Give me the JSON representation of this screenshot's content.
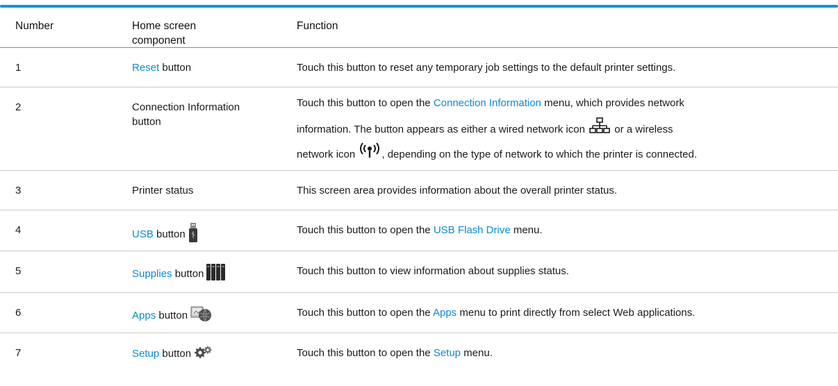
{
  "header": {
    "col1": "Number",
    "col2_line1": "Home screen",
    "col2_line2": "component",
    "col3": "Function"
  },
  "rows": [
    {
      "number": "1",
      "component_link": "Reset",
      "component_rest": " button",
      "function": "Touch this button to reset any temporary job settings to the default printer settings."
    },
    {
      "number": "2",
      "component_line1": "Connection Information",
      "component_line2": "button",
      "function_pre": "Touch this button to open the ",
      "function_link": "Connection Information",
      "function_post": " menu, which provides network",
      "function_line2_pre": "information. The button appears as either a wired network icon ",
      "function_line2_post": " or a wireless",
      "function_line3_pre": "network icon ",
      "function_line3_post": ", depending on the type of network to which the printer is connected."
    },
    {
      "number": "3",
      "component": "Printer status",
      "function": "This screen area provides information about the overall printer status."
    },
    {
      "number": "4",
      "component_link": "USB",
      "component_rest": " button",
      "icon": "usb-drive-icon",
      "function_pre": "Touch this button to open the ",
      "function_link": "USB Flash Drive",
      "function_post": " menu."
    },
    {
      "number": "5",
      "component_link": "Supplies",
      "component_rest": " button",
      "icon": "supplies-cartridges-icon",
      "function": "Touch this button to view information about supplies status."
    },
    {
      "number": "6",
      "component_link": "Apps",
      "component_rest": " button",
      "icon": "apps-globe-icon",
      "function_pre": "Touch this button to open the ",
      "function_link": "Apps",
      "function_post": " menu to print directly from select Web applications."
    },
    {
      "number": "7",
      "component_link": "Setup",
      "component_rest": " button",
      "icon": "setup-gears-icon",
      "function_pre": "Touch this button to open the ",
      "function_link": "Setup",
      "function_post": " menu."
    }
  ],
  "colors": {
    "accent_bar": "#0a96d6",
    "link": "#0a8ad0",
    "rule": "#c9c9c9"
  }
}
